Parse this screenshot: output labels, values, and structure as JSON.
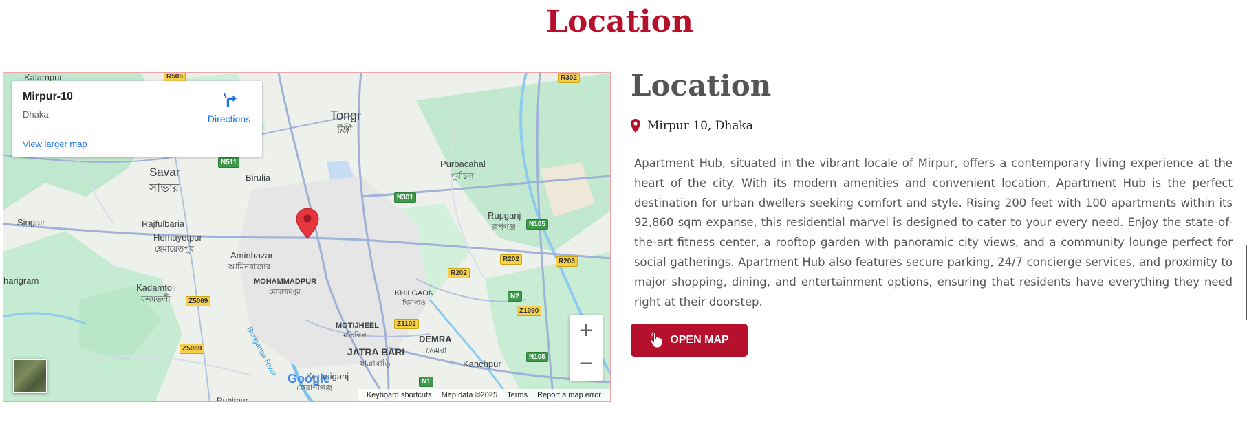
{
  "page": {
    "title": "Location"
  },
  "map": {
    "place_card": {
      "name": "Mirpur-10",
      "subtitle": "Dhaka",
      "directions_label": "Directions",
      "larger_map_label": "View larger map"
    },
    "labels": [
      {
        "text": "Kalampur",
        "size": 13
      },
      {
        "text": "Tongi",
        "size": 18
      },
      {
        "text": "টঙ্গী",
        "size": 15
      },
      {
        "text": "Savar",
        "size": 17
      },
      {
        "text": "সাভার",
        "size": 17
      },
      {
        "text": "Birulia",
        "size": 13
      },
      {
        "text": "Purbacahal",
        "size": 13
      },
      {
        "text": "পূর্বাচল",
        "size": 12
      },
      {
        "text": "Singair",
        "size": 13
      },
      {
        "text": "Rajfulbaria",
        "size": 13
      },
      {
        "text": "Hemayetpur",
        "size": 13
      },
      {
        "text": "হেমায়েতপুর",
        "size": 12
      },
      {
        "text": "Rupganj",
        "size": 13
      },
      {
        "text": "রূপগঞ্জ",
        "size": 12
      },
      {
        "text": "Aminbazar",
        "size": 13
      },
      {
        "text": "আমিনবাজার",
        "size": 12
      },
      {
        "text": "MOHAMMADPUR",
        "size": 11
      },
      {
        "text": "মোহাম্মদপুর",
        "size": 10
      },
      {
        "text": "harigram",
        "size": 13
      },
      {
        "text": "Kadamtoli",
        "size": 13
      },
      {
        "text": "কদমতলী",
        "size": 12
      },
      {
        "text": "KHILGAON",
        "size": 11
      },
      {
        "text": "খিলগাও",
        "size": 10
      },
      {
        "text": "Buriganga River",
        "size": 11
      },
      {
        "text": "MOTIJHEEL",
        "size": 11
      },
      {
        "text": "মতিঝিল",
        "size": 10
      },
      {
        "text": "DEMRA",
        "size": 13
      },
      {
        "text": "ডেমরা",
        "size": 12
      },
      {
        "text": "JATRA BARI",
        "size": 14
      },
      {
        "text": "যাত্রাবাড়ি",
        "size": 12
      },
      {
        "text": "Kanchpur",
        "size": 13
      },
      {
        "text": "Keraniganj",
        "size": 13
      },
      {
        "text": "কেরাণীগঞ্জ",
        "size": 12
      },
      {
        "text": "Ruhitpur",
        "size": 12
      }
    ],
    "road_tags": [
      {
        "text": "R505",
        "style": "yellow"
      },
      {
        "text": "R302",
        "style": "yellow"
      },
      {
        "text": "N511",
        "style": "green"
      },
      {
        "text": "N301",
        "style": "green"
      },
      {
        "text": "N105",
        "style": "green"
      },
      {
        "text": "R202",
        "style": "yellow"
      },
      {
        "text": "R203",
        "style": "yellow"
      },
      {
        "text": "R202",
        "style": "yellow"
      },
      {
        "text": "N2",
        "style": "green"
      },
      {
        "text": "Z1090",
        "style": "yellow"
      },
      {
        "text": "Z5069",
        "style": "yellow"
      },
      {
        "text": "Z1102",
        "style": "yellow"
      },
      {
        "text": "Z5069",
        "style": "yellow"
      },
      {
        "text": "N105",
        "style": "green"
      },
      {
        "text": "N1",
        "style": "green"
      }
    ],
    "zoom_in_label": "+",
    "zoom_out_label": "−",
    "google_logo": "Google",
    "attribution": {
      "shortcuts": "Keyboard shortcuts",
      "map_data": "Map data ©2025",
      "terms": "Terms",
      "report": "Report a map error"
    }
  },
  "info": {
    "title": "Location",
    "address": "Mirpur 10, Dhaka",
    "description": "Apartment Hub, situated in the vibrant locale of Mirpur, offers a contemporary living experience at the heart of the city. With its modern amenities and convenient location, Apartment Hub is the perfect destination for urban dwellers seeking comfort and style. Rising 200 feet with 100 apartments within its 92,860 sqm expanse, this residential marvel is designed to cater to your every need. Enjoy the state-of-the-art fitness center, a rooftop garden with panoramic city views, and a community lounge perfect for social gatherings. Apartment Hub also features secure parking, 24/7 concierge services, and proximity to major shopping, dining, and entertainment options, ensuring that residents have everything they need right at their doorstep.",
    "button_label": "OPEN MAP"
  },
  "colors": {
    "accent": "#b5102c",
    "title_gray": "#555555",
    "link_blue": "#1a73e8"
  },
  "icons": {
    "address": "map-marker-icon",
    "button": "hand-pointer-icon",
    "directions": "directions-arrow-icon"
  }
}
